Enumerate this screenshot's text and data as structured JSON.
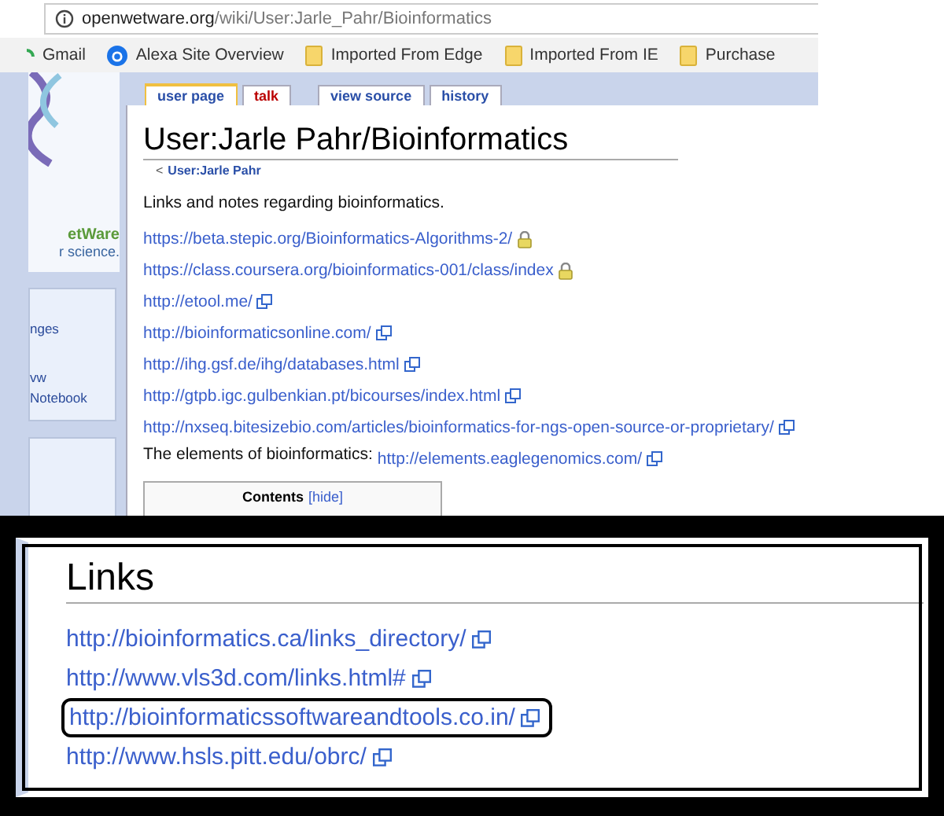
{
  "address_bar": {
    "host": "openwetware.org",
    "path": "/wiki/User:Jarle_Pahr/Bioinformatics"
  },
  "bookmarks": [
    {
      "label": "Gmail",
      "kind": "gmail"
    },
    {
      "label": "Alexa Site Overview",
      "kind": "alexa"
    },
    {
      "label": "Imported From Edge",
      "kind": "folder"
    },
    {
      "label": "Imported From IE",
      "kind": "folder"
    },
    {
      "label": "Purchase",
      "kind": "folder"
    }
  ],
  "sidebar": {
    "logo_lines": [
      "etWare",
      "r science."
    ],
    "nav_items": [
      "nges",
      "vw",
      "Notebook"
    ]
  },
  "tabs": [
    {
      "label": "user page",
      "selected": true,
      "missing": false
    },
    {
      "label": "talk",
      "selected": false,
      "missing": true
    },
    {
      "label": "view source",
      "selected": false,
      "missing": false
    },
    {
      "label": "history",
      "selected": false,
      "missing": false
    }
  ],
  "title": "User:Jarle Pahr/Bioinformatics",
  "breadcrumb": {
    "prefix": "<",
    "link": "User:Jarle Pahr"
  },
  "intro": "Links and notes regarding bioinformatics.",
  "links": [
    {
      "url": "https://beta.stepic.org/Bioinformatics-Algorithms-2/",
      "kind": "secure"
    },
    {
      "url": "https://class.coursera.org/bioinformatics-001/class/index",
      "kind": "secure"
    },
    {
      "url": "http://etool.me/",
      "kind": "external"
    },
    {
      "url": "http://bioinformaticsonline.com/",
      "kind": "external"
    },
    {
      "url": "http://ihg.gsf.de/ihg/databases.html",
      "kind": "external"
    },
    {
      "url": "http://gtpb.igc.gulbenkian.pt/bicourses/index.html",
      "kind": "external"
    },
    {
      "url": "http://nxseq.bitesizebio.com/articles/bioinformatics-for-ngs-open-source-or-proprietary/",
      "kind": "external"
    }
  ],
  "elements_line": {
    "text": "The elements of bioinformatics:",
    "url": "http://elements.eaglegenomics.com/"
  },
  "contents": {
    "title": "Contents",
    "toggle": "[hide]"
  },
  "inset": {
    "heading": "Links",
    "links": [
      {
        "url": "http://bioinformatics.ca/links_directory/",
        "highlighted": false
      },
      {
        "url": "http://www.vls3d.com/links.html#",
        "highlighted": false
      },
      {
        "url": "http://bioinformaticssoftwareandtools.co.in/",
        "highlighted": true
      },
      {
        "url": "http://www.hsls.pitt.edu/obrc/",
        "highlighted": false
      }
    ]
  }
}
